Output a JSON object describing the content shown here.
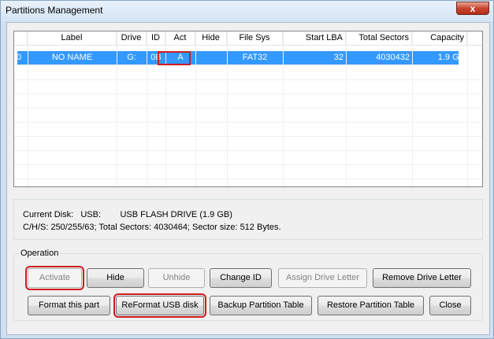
{
  "window": {
    "title": "Partitions Management",
    "close_label": "x"
  },
  "table": {
    "headers": [
      "",
      "Label",
      "Drive",
      "ID",
      "Act",
      "Hide",
      "File Sys",
      "Start LBA",
      "Total Sectors",
      "Capacity"
    ],
    "rows": [
      [
        "0",
        "NO NAME",
        "G:",
        "0B",
        "A",
        "",
        "FAT32",
        "32",
        "4030432",
        "1.9 GB"
      ]
    ]
  },
  "info": {
    "line1": "Current Disk:   USB:        USB FLASH DRIVE (1.9 GB)",
    "line2": "C/H/S: 250/255/63; Total Sectors: 4030464; Sector size: 512 Bytes."
  },
  "operation": {
    "title": "Operation",
    "activate": "Activate",
    "hide": "Hide",
    "unhide": "Unhide",
    "change_id": "Change ID",
    "assign_drive_letter": "Assign Drive Letter",
    "remove_drive_letter": "Remove Drive Letter",
    "format_part": "Format this part",
    "reformat_usb": "ReFormat USB disk",
    "backup_table": "Backup Partition Table",
    "restore_table": "Restore Partition Table",
    "close": "Close"
  }
}
